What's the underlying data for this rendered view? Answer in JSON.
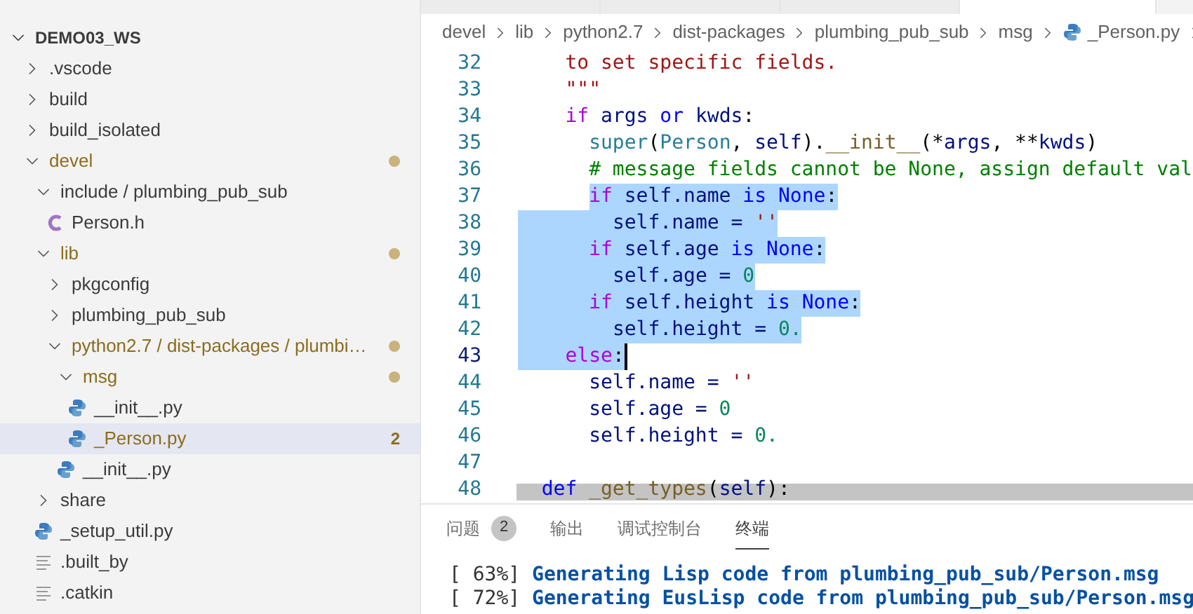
{
  "explorer": {
    "root": {
      "label": "DEMO03_WS",
      "expanded": true,
      "children": [
        {
          "kind": "folder",
          "label": ".vscode",
          "expanded": false
        },
        {
          "kind": "folder",
          "label": "build",
          "expanded": false
        },
        {
          "kind": "folder",
          "label": "build_isolated",
          "expanded": false
        },
        {
          "kind": "folder",
          "label": "devel",
          "expanded": true,
          "modified": true,
          "children": [
            {
              "kind": "folder",
              "label": "include / plumbing_pub_sub",
              "expanded": true,
              "children": [
                {
                  "kind": "c",
                  "label": "Person.h",
                  "selected": false
                }
              ]
            },
            {
              "kind": "folder",
              "label": "lib",
              "expanded": true,
              "modified": true,
              "children": [
                {
                  "kind": "folder",
                  "label": "pkgconfig",
                  "expanded": false
                },
                {
                  "kind": "folder",
                  "label": "plumbing_pub_sub",
                  "expanded": false
                },
                {
                  "kind": "folder",
                  "label": "python2.7 / dist-packages / plumbi…",
                  "expanded": true,
                  "modified": true,
                  "children": [
                    {
                      "kind": "folder",
                      "label": "msg",
                      "expanded": true,
                      "modified": true,
                      "children": [
                        {
                          "kind": "python",
                          "label": "__init__.py",
                          "selected": false
                        },
                        {
                          "kind": "python",
                          "label": "_Person.py",
                          "selected": true,
                          "problems": "2"
                        }
                      ]
                    },
                    {
                      "kind": "python",
                      "label": "__init__.py",
                      "selected": false
                    }
                  ]
                }
              ]
            },
            {
              "kind": "folder",
              "label": "share",
              "expanded": false
            },
            {
              "kind": "python",
              "label": "_setup_util.py",
              "selected": false
            },
            {
              "kind": "text",
              "label": ".built_by",
              "selected": false
            },
            {
              "kind": "text",
              "label": ".catkin",
              "selected": false
            }
          ]
        }
      ]
    }
  },
  "editor_tabs": [
    {
      "selected": false
    },
    {
      "selected": false
    },
    {
      "selected": false
    },
    {
      "selected": true
    }
  ],
  "breadcrumbs": [
    {
      "label": "devel"
    },
    {
      "label": "lib"
    },
    {
      "label": "python2.7"
    },
    {
      "label": "dist-packages"
    },
    {
      "label": "plumbing_pub_sub"
    },
    {
      "label": "msg"
    },
    {
      "label": "_Person.py",
      "kind": "python"
    }
  ],
  "code": [
    {
      "number": "32",
      "tokens": [
        {
          "text": "    to set specific fields.",
          "kind": "string"
        }
      ]
    },
    {
      "number": "33",
      "tokens": [
        {
          "text": "    \"\"\"",
          "kind": "string"
        }
      ]
    },
    {
      "number": "34",
      "tokens": [
        {
          "text": "    if ",
          "kind": "keyword"
        },
        {
          "text": "args ",
          "kind": "variable"
        },
        {
          "text": "or ",
          "kind": "operator"
        },
        {
          "text": "kwds",
          "kind": "variable"
        },
        {
          "text": ":",
          "kind": "plain"
        }
      ]
    },
    {
      "number": "35",
      "tokens": [
        {
          "text": "      super",
          "kind": "class"
        },
        {
          "text": "(",
          "kind": "plain"
        },
        {
          "text": "Person",
          "kind": "class"
        },
        {
          "text": ", ",
          "kind": "plain"
        },
        {
          "text": "self",
          "kind": "variable"
        },
        {
          "text": ").",
          "kind": "plain"
        },
        {
          "text": "__init__",
          "kind": "function"
        },
        {
          "text": "(*",
          "kind": "plain"
        },
        {
          "text": "args",
          "kind": "variable"
        },
        {
          "text": ", **",
          "kind": "plain"
        },
        {
          "text": "kwds",
          "kind": "variable"
        },
        {
          "text": ")",
          "kind": "plain"
        }
      ]
    },
    {
      "number": "36",
      "tokens": [
        {
          "text": "      # message fields cannot be None, assign default val",
          "kind": "comment"
        }
      ]
    },
    {
      "number": "37",
      "selected": true,
      "tokens": [
        {
          "text": "      if ",
          "kind": "keyword"
        },
        {
          "text": "self.name ",
          "kind": "variable"
        },
        {
          "text": "is None",
          "kind": "operator"
        },
        {
          "text": ":",
          "kind": "plain"
        }
      ]
    },
    {
      "number": "38",
      "selected": true,
      "tokens": [
        {
          "text": "        self.name = ",
          "kind": "variable"
        },
        {
          "text": "''",
          "kind": "string"
        }
      ]
    },
    {
      "number": "39",
      "selected": true,
      "tokens": [
        {
          "text": "      if ",
          "kind": "keyword"
        },
        {
          "text": "self.age ",
          "kind": "variable"
        },
        {
          "text": "is None",
          "kind": "operator"
        },
        {
          "text": ":",
          "kind": "plain"
        }
      ]
    },
    {
      "number": "40",
      "selected": true,
      "tokens": [
        {
          "text": "        self.age = ",
          "kind": "variable"
        },
        {
          "text": "0",
          "kind": "number"
        }
      ]
    },
    {
      "number": "41",
      "selected": true,
      "tokens": [
        {
          "text": "      if ",
          "kind": "keyword"
        },
        {
          "text": "self.height ",
          "kind": "variable"
        },
        {
          "text": "is None",
          "kind": "operator"
        },
        {
          "text": ":",
          "kind": "plain"
        }
      ]
    },
    {
      "number": "42",
      "selected": true,
      "tokens": [
        {
          "text": "        self.height = ",
          "kind": "variable"
        },
        {
          "text": "0.",
          "kind": "number"
        }
      ]
    },
    {
      "number": "43",
      "selected": true,
      "cursor": true,
      "tokens": [
        {
          "text": "    else",
          "kind": "keyword"
        },
        {
          "text": ":",
          "kind": "plain"
        }
      ]
    },
    {
      "number": "44",
      "tokens": [
        {
          "text": "      self.name = ",
          "kind": "variable"
        },
        {
          "text": "''",
          "kind": "string"
        }
      ]
    },
    {
      "number": "45",
      "tokens": [
        {
          "text": "      self.age = ",
          "kind": "variable"
        },
        {
          "text": "0",
          "kind": "number"
        }
      ]
    },
    {
      "number": "46",
      "tokens": [
        {
          "text": "      self.height = ",
          "kind": "variable"
        },
        {
          "text": "0.",
          "kind": "number"
        }
      ]
    },
    {
      "number": "47"
    },
    {
      "number": "48",
      "tokens": [
        {
          "text": "  def ",
          "kind": "operator"
        },
        {
          "text": "_get_types",
          "kind": "function"
        },
        {
          "text": "(",
          "kind": "plain"
        },
        {
          "text": "self",
          "kind": "variable"
        },
        {
          "text": "):",
          "kind": "plain"
        }
      ]
    }
  ],
  "panel": {
    "tabs": [
      {
        "label": "问题",
        "badge": "2",
        "selected": false
      },
      {
        "label": "输出",
        "selected": false
      },
      {
        "label": "调试控制台",
        "selected": false
      },
      {
        "label": "终端",
        "selected": true
      }
    ],
    "terminal": [
      {
        "progress": "[ 63%]",
        "message": "Generating Lisp code from plumbing_pub_sub/Person.msg"
      },
      {
        "progress": "[ 72%]",
        "message": "Generating EusLisp code from plumbing_pub_sub/Person.msg"
      }
    ]
  }
}
